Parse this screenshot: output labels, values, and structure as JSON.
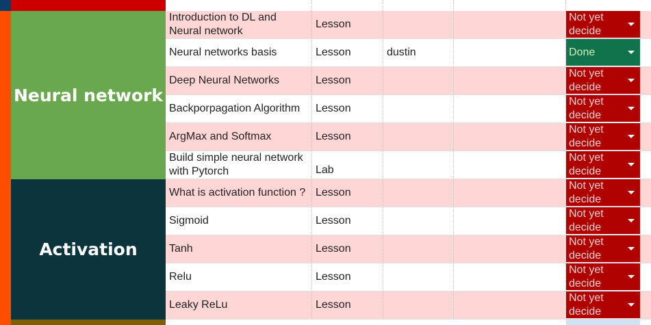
{
  "colors": {
    "left_strip_orange": "#ff4e00",
    "top_strip_blue": "#0b3d6b",
    "top_group_red": "#cc0000",
    "group_neural": "#6aa84f",
    "group_activation": "#0c343d",
    "bottom_group_olive": "#7f6000",
    "row_pink": "#ffd6d6",
    "status_not_decided": "#b10202",
    "status_done": "#11734b"
  },
  "groups": [
    {
      "label": "Neural network"
    },
    {
      "label": "Activation"
    }
  ],
  "rows": [
    {
      "title": "Introduction to DL and Neural network",
      "type": "Lesson",
      "owner": "",
      "status": "Not yet decide"
    },
    {
      "title": "Neural networks basis",
      "type": "Lesson",
      "owner": "dustin",
      "status": "Done"
    },
    {
      "title": "Deep Neural Networks",
      "type": "Lesson",
      "owner": "",
      "status": "Not yet decide"
    },
    {
      "title": "Backporpagation Algorithm",
      "type": "Lesson",
      "owner": "",
      "status": "Not yet decide"
    },
    {
      "title": "ArgMax and Softmax",
      "type": "Lesson",
      "owner": "",
      "status": "Not yet decide"
    },
    {
      "title": "Build simple neural network with Pytorch",
      "type": "Lab",
      "owner": "",
      "status": "Not yet decide"
    },
    {
      "title": "What is activation function ?",
      "type": "Lesson",
      "owner": "",
      "status": "Not yet decide"
    },
    {
      "title": "Sigmoid",
      "type": "Lesson",
      "owner": "",
      "status": "Not yet decide"
    },
    {
      "title": "Tanh",
      "type": "Lesson",
      "owner": "",
      "status": "Not yet decide"
    },
    {
      "title": "Relu",
      "type": "Lesson",
      "owner": "",
      "status": "Not yet decide"
    },
    {
      "title": "Leaky ReLu",
      "type": "Lesson",
      "owner": "",
      "status": "Not yet decide"
    }
  ]
}
